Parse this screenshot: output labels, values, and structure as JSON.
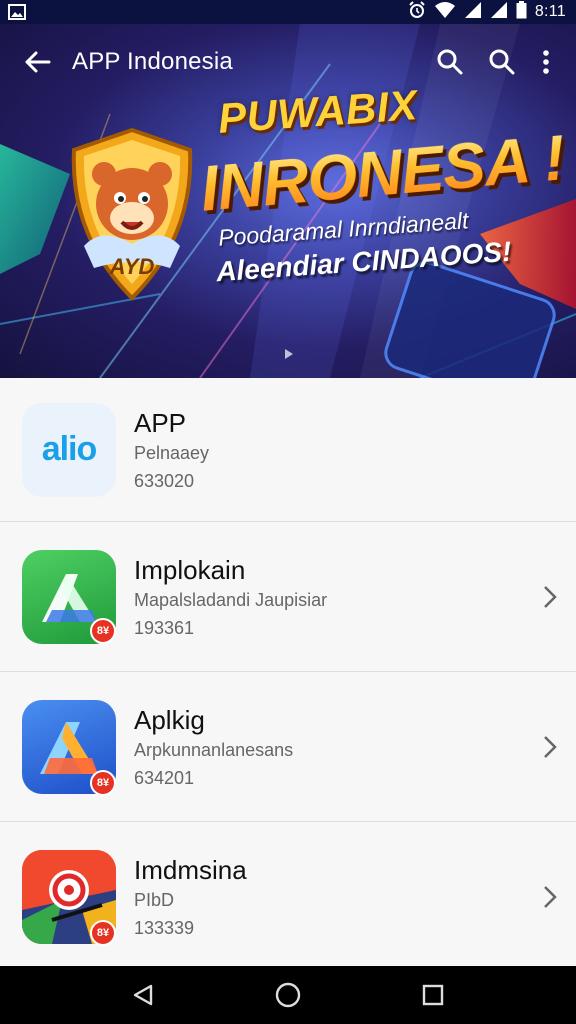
{
  "status_bar": {
    "time": "8:11",
    "icons": [
      "image-icon",
      "alarm-icon",
      "wifi-icon",
      "signal-icon",
      "signal-icon",
      "battery-icon"
    ]
  },
  "toolbar": {
    "title": "APP Indonesia",
    "icons": [
      "back-arrow-icon",
      "search-icon",
      "search-icon",
      "more-vert-icon"
    ]
  },
  "banner": {
    "line1": "PUWABIX",
    "line2": "INRONESA !",
    "line3": "Poodaramal Inrndianealt",
    "line4": "Aleendiar CINDAOOS!",
    "mascot_badge": "AYD"
  },
  "apps": [
    {
      "name": "APP",
      "subtitle": "Pelnaaey",
      "count": "633020",
      "icon_text": "alio",
      "icon_color": "#eaf3fc",
      "has_chevron": false,
      "badge": ""
    },
    {
      "name": "Implokain",
      "subtitle": "Mapalsladandi Jaupisiar",
      "count": "193361",
      "icon_color": "#2fb34a",
      "has_chevron": true,
      "badge": "8¥"
    },
    {
      "name": "Aplkig",
      "subtitle": "Arpkunnanlanesans",
      "count": "634201",
      "icon_color": "#2b6fe0",
      "has_chevron": true,
      "badge": "8¥"
    },
    {
      "name": "Imdmsina",
      "subtitle": "PIbD",
      "count": "133339",
      "icon_color": "#d93a2b",
      "has_chevron": true,
      "badge": "8¥"
    }
  ],
  "nav_bar": {
    "buttons": [
      "back-triangle-icon",
      "home-circle-icon",
      "recents-square-icon"
    ]
  }
}
